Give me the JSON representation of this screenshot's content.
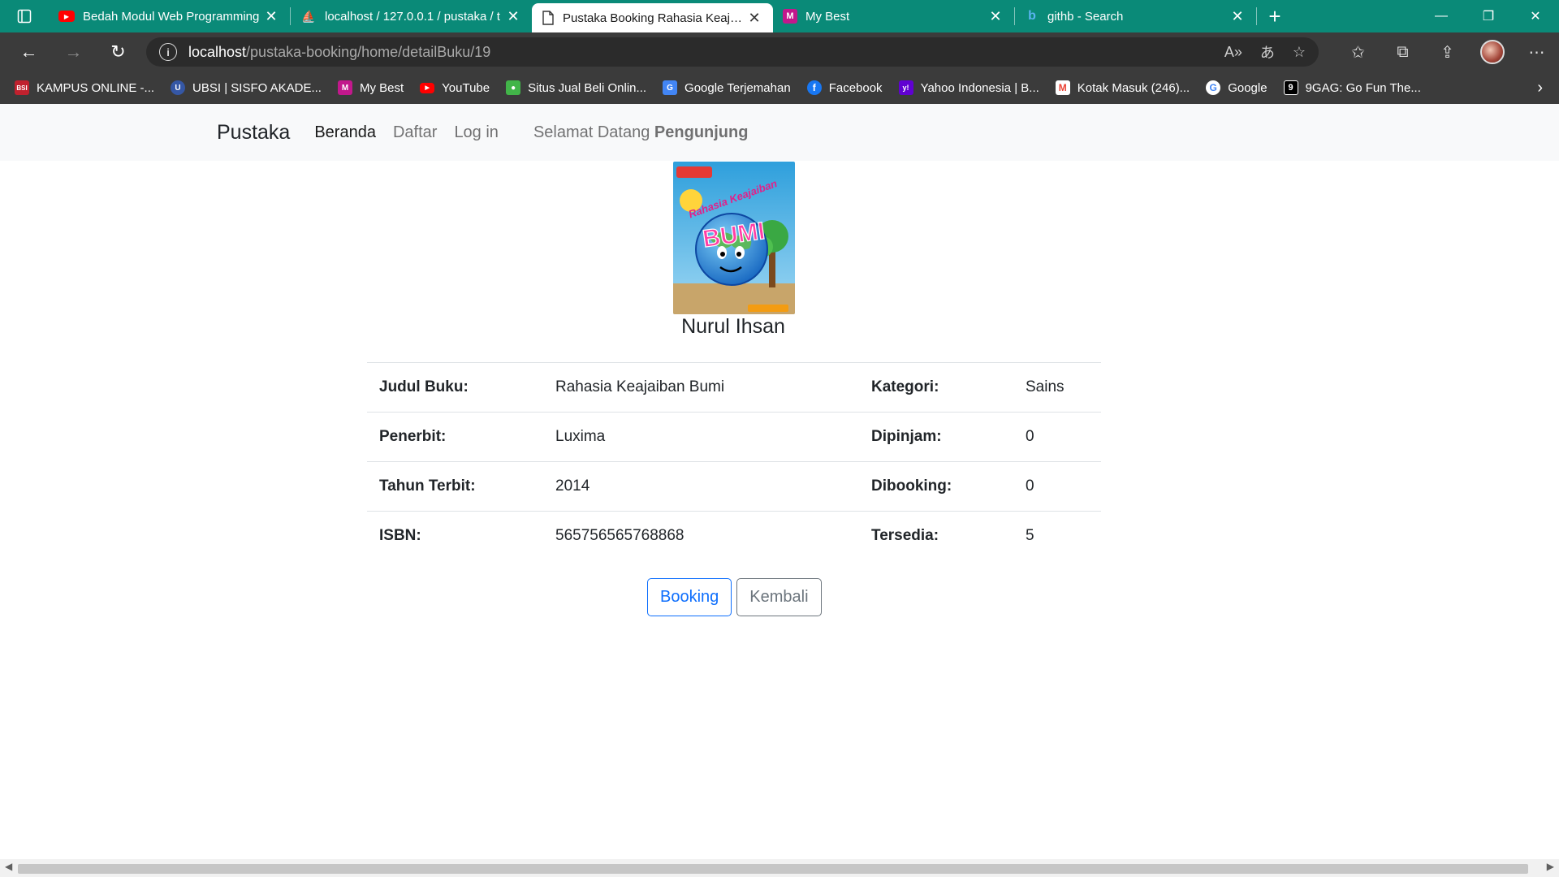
{
  "browser": {
    "tabs": [
      {
        "title": "Bedah Modul Web Programming",
        "icon": "youtube-icon",
        "color": "#ff0000"
      },
      {
        "title": "localhost / 127.0.0.1 / pustaka / t",
        "icon": "phpmyadmin-icon",
        "color": "#f6a623"
      },
      {
        "title": "Pustaka Booking Rahasia Keajaib",
        "icon": "page-icon",
        "color": "#555555"
      },
      {
        "title": "My Best",
        "icon": "mybest-icon",
        "color": "#c2188c"
      },
      {
        "title": "githb - Search",
        "icon": "bing-icon",
        "color": "#2a7fd4"
      }
    ],
    "url_host": "localhost",
    "url_path": "/pustaka-booking/home/detailBuku/19",
    "bookmarks": [
      {
        "label": "KAMPUS ONLINE -...",
        "icon": "bsi-icon",
        "color": "#c0212e",
        "glyph": "BSI"
      },
      {
        "label": "UBSI | SISFO AKADE...",
        "icon": "ubsi-icon",
        "color": "#3557a5",
        "glyph": "U"
      },
      {
        "label": "My Best",
        "icon": "mybest-icon",
        "color": "#c2188c",
        "glyph": "M"
      },
      {
        "label": "YouTube",
        "icon": "youtube-icon",
        "color": "#ff0000",
        "glyph": "▶"
      },
      {
        "label": "Situs Jual Beli Onlin...",
        "icon": "tokopedia-icon",
        "color": "#42b549",
        "glyph": "●"
      },
      {
        "label": "Google Terjemahan",
        "icon": "google-translate-icon",
        "color": "#4285f4",
        "glyph": "G"
      },
      {
        "label": "Facebook",
        "icon": "facebook-icon",
        "color": "#1877f2",
        "glyph": "f"
      },
      {
        "label": "Yahoo Indonesia | B...",
        "icon": "yahoo-icon",
        "color": "#6001d2",
        "glyph": "y!"
      },
      {
        "label": "Kotak Masuk (246)...",
        "icon": "gmail-icon",
        "color": "#ea4335",
        "glyph": "M"
      },
      {
        "label": "Google",
        "icon": "google-icon",
        "color": "#ffffff",
        "glyph": "G"
      },
      {
        "label": "9GAG: Go Fun The...",
        "icon": "9gag-icon",
        "color": "#000000",
        "glyph": "9"
      }
    ]
  },
  "site": {
    "brand": "Pustaka",
    "nav": {
      "home": "Beranda",
      "register": "Daftar",
      "login": "Log in"
    },
    "greeting": "Selamat Datang",
    "visitor": "Pengunjung"
  },
  "book": {
    "author": "Nurul Ihsan",
    "cover_title": "Rahasia Keajaiban",
    "cover_word": "BUMI",
    "rows": [
      {
        "label1": "Judul Buku:",
        "value1": "Rahasia Keajaiban Bumi",
        "label2": "Kategori:",
        "value2": "Sains"
      },
      {
        "label1": "Penerbit:",
        "value1": "Luxima",
        "label2": "Dipinjam:",
        "value2": "0"
      },
      {
        "label1": "Tahun Terbit:",
        "value1": "2014",
        "label2": "Dibooking:",
        "value2": "0"
      },
      {
        "label1": "ISBN:",
        "value1": "565756565768868",
        "label2": "Tersedia:",
        "value2": "5"
      }
    ]
  },
  "actions": {
    "booking": "Booking",
    "back": "Kembali"
  }
}
